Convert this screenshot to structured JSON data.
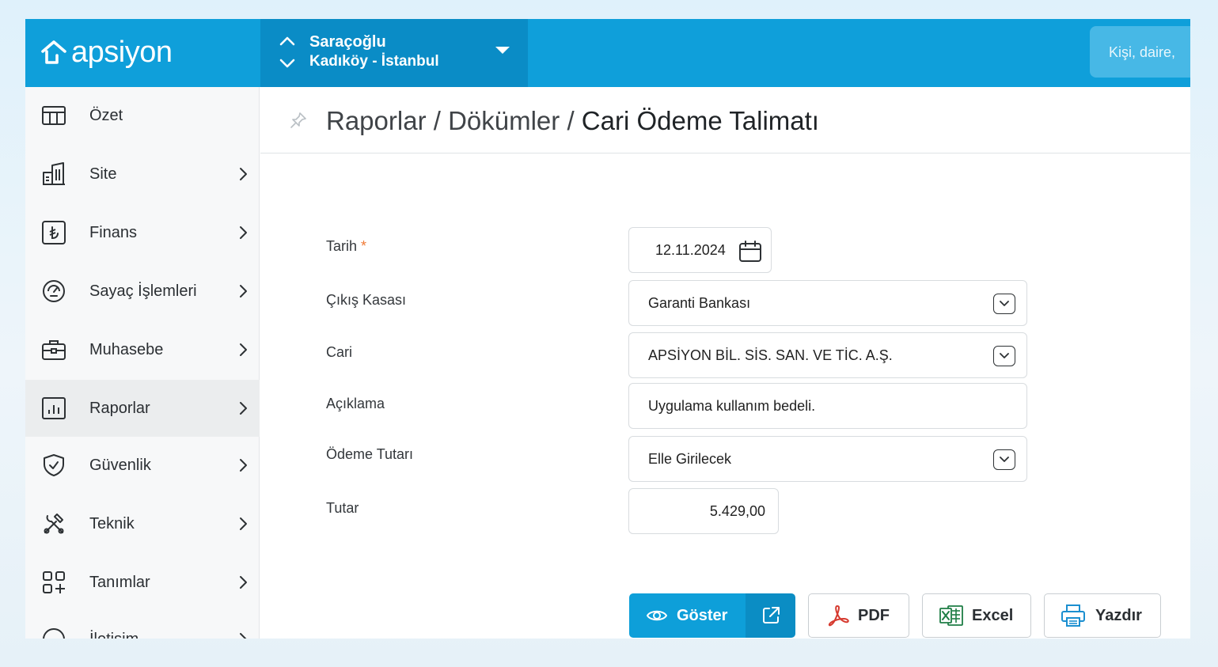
{
  "brand": {
    "name": "apsiyon"
  },
  "site": {
    "name": "Saraçoğlu",
    "location": "Kadıköy - İstanbul"
  },
  "search": {
    "placeholder": "Kişi, daire, "
  },
  "sidebar": {
    "items": [
      {
        "label": "Özet",
        "icon": "table-icon",
        "has_children": false
      },
      {
        "label": "Site",
        "icon": "building-icon",
        "has_children": true
      },
      {
        "label": "Finans",
        "icon": "lira-icon",
        "has_children": true
      },
      {
        "label": "Sayaç İşlemleri",
        "icon": "gauge-icon",
        "has_children": true
      },
      {
        "label": "Muhasebe",
        "icon": "briefcase-icon",
        "has_children": true
      },
      {
        "label": "Raporlar",
        "icon": "bar-chart-icon",
        "has_children": true,
        "active": true
      },
      {
        "label": "Güvenlik",
        "icon": "shield-icon",
        "has_children": true
      },
      {
        "label": "Teknik",
        "icon": "tools-icon",
        "has_children": true
      },
      {
        "label": "Tanımlar",
        "icon": "grid-plus-icon",
        "has_children": true
      },
      {
        "label": "İletişim",
        "icon": "chat-icon",
        "has_children": true
      }
    ]
  },
  "breadcrumb": {
    "part1": "Raporlar",
    "part2": "Dökümler",
    "current": "Cari Ödeme Talimatı",
    "separator": "/"
  },
  "form": {
    "date": {
      "label": "Tarih",
      "required_mark": "*",
      "value": "12.11.2024"
    },
    "cash_account": {
      "label": "Çıkış Kasası",
      "value": "Garanti Bankası"
    },
    "account": {
      "label": "Cari",
      "value": "APSİYON BİL. SİS. SAN. VE TİC. A.Ş."
    },
    "description": {
      "label": "Açıklama",
      "value": "Uygulama kullanım bedeli."
    },
    "payment_amount": {
      "label": "Ödeme Tutarı",
      "value": "Elle Girilecek"
    },
    "amount": {
      "label": "Tutar",
      "value": "5.429,00"
    }
  },
  "actions": {
    "show": "Göster",
    "pdf": "PDF",
    "excel": "Excel",
    "print": "Yazdır"
  },
  "colors": {
    "primary": "#0f9fda",
    "primary_dark": "#0a8cc6",
    "pdf_red": "#d63a2f",
    "excel_green": "#1e7d45",
    "print_blue": "#1b8fd0"
  }
}
